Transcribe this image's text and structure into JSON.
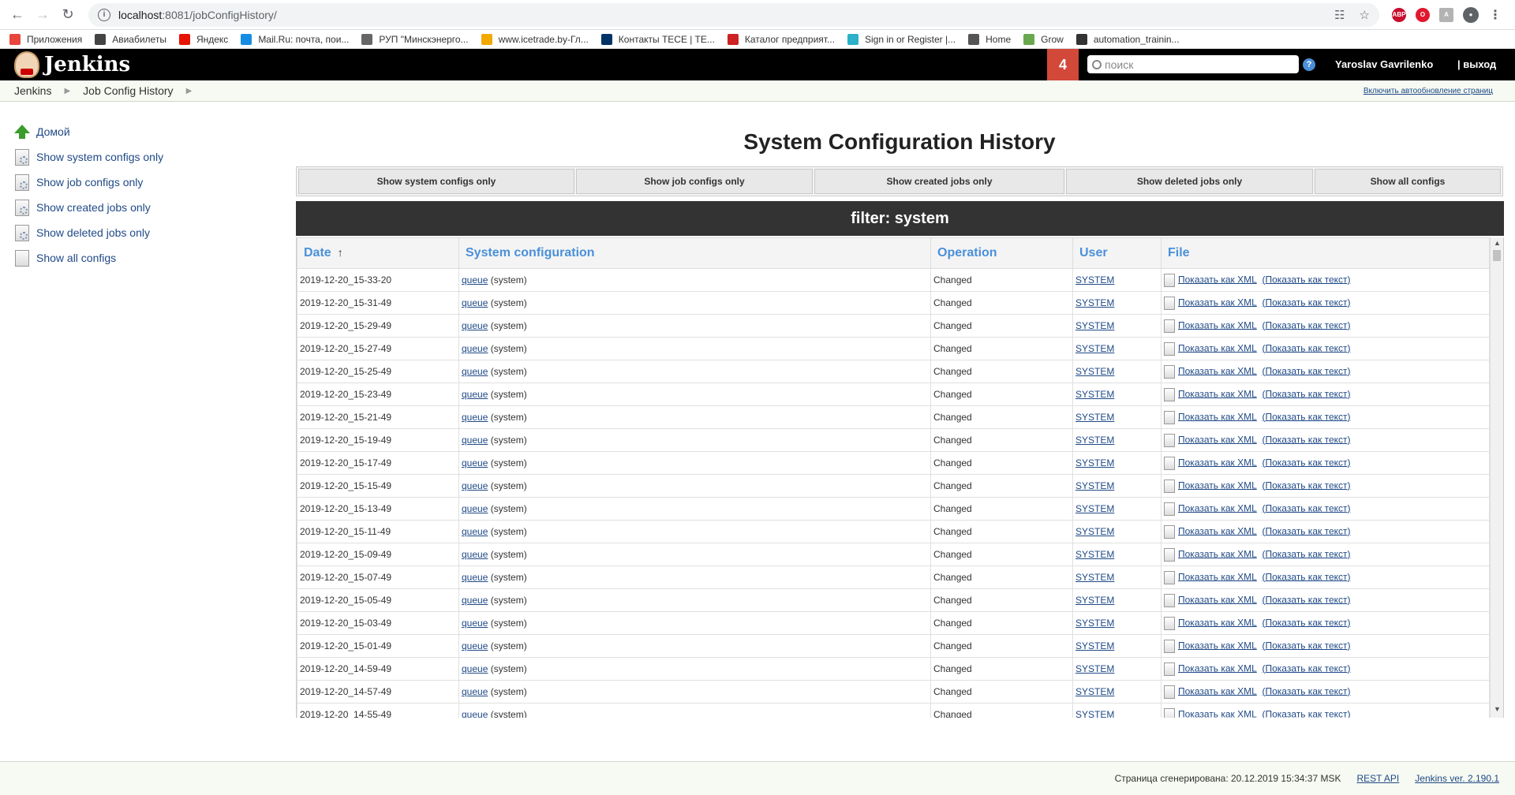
{
  "browser": {
    "url_host": "localhost",
    "url_path": ":8081/jobConfigHistory/",
    "bookmarks": [
      {
        "label": "Приложения",
        "color": "#e8453c"
      },
      {
        "label": "Авиабилеты",
        "color": "#444444"
      },
      {
        "label": "Яндекс",
        "color": "#e61400"
      },
      {
        "label": "Mail.Ru: почта, пои...",
        "color": "#168de2"
      },
      {
        "label": "РУП \"Минскэнерго...",
        "color": "#666666"
      },
      {
        "label": "www.icetrade.by-Гл...",
        "color": "#f2a900"
      },
      {
        "label": "Контакты TECE | TE...",
        "color": "#003366"
      },
      {
        "label": "Каталог предприят...",
        "color": "#cc2222"
      },
      {
        "label": "Sign in or Register |...",
        "color": "#2bb1c9"
      },
      {
        "label": "Home",
        "color": "#555555"
      },
      {
        "label": "Grow",
        "color": "#6aa84f"
      },
      {
        "label": "automation_trainin...",
        "color": "#333333"
      }
    ]
  },
  "header": {
    "title": "Jenkins",
    "build_count": "4",
    "search_placeholder": "поиск",
    "help": "?",
    "user": "Yaroslav Gavrilenko",
    "logout": "| выход"
  },
  "breadcrumb": {
    "items": [
      "Jenkins",
      "Job Config History"
    ],
    "autorefresh": "Включить автообновление страниц"
  },
  "side_panel": {
    "tasks": [
      {
        "label": "Домой",
        "icon": "home-arrow-icon"
      },
      {
        "label": "Show system configs only",
        "icon": "config-icon"
      },
      {
        "label": "Show job configs only",
        "icon": "config-icon"
      },
      {
        "label": "Show created jobs only",
        "icon": "config-icon"
      },
      {
        "label": "Show deleted jobs only",
        "icon": "config-icon"
      },
      {
        "label": "Show all configs",
        "icon": "document-icon"
      }
    ]
  },
  "main": {
    "title": "System Configuration History",
    "filter_buttons": [
      "Show system configs only",
      "Show job configs only",
      "Show created jobs only",
      "Show deleted jobs only",
      "Show all configs"
    ],
    "filter_banner": "filter: system",
    "table": {
      "headers": [
        "Date",
        "System configuration",
        "Operation",
        "User",
        "File"
      ],
      "sort_indicator": "↑",
      "rows": [
        {
          "date": "2019-12-20_15-33-20",
          "config": "queue",
          "config_suffix": " (system)",
          "operation": "Changed",
          "user": "SYSTEM",
          "xml": "Показать как XML",
          "text": "(Показать как текст)"
        },
        {
          "date": "2019-12-20_15-31-49",
          "config": "queue",
          "config_suffix": " (system)",
          "operation": "Changed",
          "user": "SYSTEM",
          "xml": "Показать как XML",
          "text": "(Показать как текст)"
        },
        {
          "date": "2019-12-20_15-29-49",
          "config": "queue",
          "config_suffix": " (system)",
          "operation": "Changed",
          "user": "SYSTEM",
          "xml": "Показать как XML",
          "text": "(Показать как текст)"
        },
        {
          "date": "2019-12-20_15-27-49",
          "config": "queue",
          "config_suffix": " (system)",
          "operation": "Changed",
          "user": "SYSTEM",
          "xml": "Показать как XML",
          "text": "(Показать как текст)"
        },
        {
          "date": "2019-12-20_15-25-49",
          "config": "queue",
          "config_suffix": " (system)",
          "operation": "Changed",
          "user": "SYSTEM",
          "xml": "Показать как XML",
          "text": "(Показать как текст)"
        },
        {
          "date": "2019-12-20_15-23-49",
          "config": "queue",
          "config_suffix": " (system)",
          "operation": "Changed",
          "user": "SYSTEM",
          "xml": "Показать как XML",
          "text": "(Показать как текст)"
        },
        {
          "date": "2019-12-20_15-21-49",
          "config": "queue",
          "config_suffix": " (system)",
          "operation": "Changed",
          "user": "SYSTEM",
          "xml": "Показать как XML",
          "text": "(Показать как текст)"
        },
        {
          "date": "2019-12-20_15-19-49",
          "config": "queue",
          "config_suffix": " (system)",
          "operation": "Changed",
          "user": "SYSTEM",
          "xml": "Показать как XML",
          "text": "(Показать как текст)"
        },
        {
          "date": "2019-12-20_15-17-49",
          "config": "queue",
          "config_suffix": " (system)",
          "operation": "Changed",
          "user": "SYSTEM",
          "xml": "Показать как XML",
          "text": "(Показать как текст)"
        },
        {
          "date": "2019-12-20_15-15-49",
          "config": "queue",
          "config_suffix": " (system)",
          "operation": "Changed",
          "user": "SYSTEM",
          "xml": "Показать как XML",
          "text": "(Показать как текст)"
        },
        {
          "date": "2019-12-20_15-13-49",
          "config": "queue",
          "config_suffix": " (system)",
          "operation": "Changed",
          "user": "SYSTEM",
          "xml": "Показать как XML",
          "text": "(Показать как текст)"
        },
        {
          "date": "2019-12-20_15-11-49",
          "config": "queue",
          "config_suffix": " (system)",
          "operation": "Changed",
          "user": "SYSTEM",
          "xml": "Показать как XML",
          "text": "(Показать как текст)"
        },
        {
          "date": "2019-12-20_15-09-49",
          "config": "queue",
          "config_suffix": " (system)",
          "operation": "Changed",
          "user": "SYSTEM",
          "xml": "Показать как XML",
          "text": "(Показать как текст)"
        },
        {
          "date": "2019-12-20_15-07-49",
          "config": "queue",
          "config_suffix": " (system)",
          "operation": "Changed",
          "user": "SYSTEM",
          "xml": "Показать как XML",
          "text": "(Показать как текст)"
        },
        {
          "date": "2019-12-20_15-05-49",
          "config": "queue",
          "config_suffix": " (system)",
          "operation": "Changed",
          "user": "SYSTEM",
          "xml": "Показать как XML",
          "text": "(Показать как текст)"
        },
        {
          "date": "2019-12-20_15-03-49",
          "config": "queue",
          "config_suffix": " (system)",
          "operation": "Changed",
          "user": "SYSTEM",
          "xml": "Показать как XML",
          "text": "(Показать как текст)"
        },
        {
          "date": "2019-12-20_15-01-49",
          "config": "queue",
          "config_suffix": " (system)",
          "operation": "Changed",
          "user": "SYSTEM",
          "xml": "Показать как XML",
          "text": "(Показать как текст)"
        },
        {
          "date": "2019-12-20_14-59-49",
          "config": "queue",
          "config_suffix": " (system)",
          "operation": "Changed",
          "user": "SYSTEM",
          "xml": "Показать как XML",
          "text": "(Показать как текст)"
        },
        {
          "date": "2019-12-20_14-57-49",
          "config": "queue",
          "config_suffix": " (system)",
          "operation": "Changed",
          "user": "SYSTEM",
          "xml": "Показать как XML",
          "text": "(Показать как текст)"
        },
        {
          "date": "2019-12-20_14-55-49",
          "config": "queue",
          "config_suffix": " (system)",
          "operation": "Changed",
          "user": "SYSTEM",
          "xml": "Показать как XML",
          "text": "(Показать как текст)"
        }
      ]
    }
  },
  "footer": {
    "generated": "Страница сгенерирована: 20.12.2019 15:34:37 MSK",
    "rest_api": "REST API",
    "version": "Jenkins ver. 2.190.1"
  }
}
